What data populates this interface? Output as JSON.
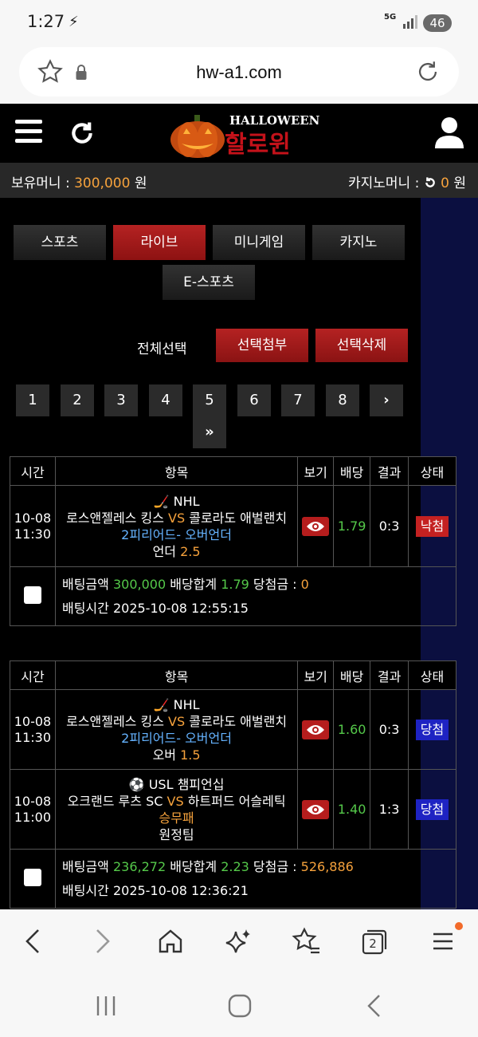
{
  "status_bar": {
    "time": "1:27",
    "network": "5G",
    "battery": "46"
  },
  "browser": {
    "url": "hw-a1.com"
  },
  "header": {
    "logo_top": "HALLOWEEN",
    "logo_main": "할로윈"
  },
  "money": {
    "holding_label": "보유머니 :",
    "holding_value": "300,000",
    "holding_unit": "원",
    "casino_label": "카지노머니 :",
    "casino_value": "0",
    "casino_unit": "원"
  },
  "tabs": [
    "스포츠",
    "라이브",
    "미니게임",
    "카지노",
    "E-스포츠"
  ],
  "active_tab": "라이브",
  "actions": {
    "select_all": "전체선택",
    "attach": "선택첨부",
    "delete": "선택삭제"
  },
  "pagination": [
    "1",
    "2",
    "3",
    "4",
    "5",
    "6",
    "7",
    "8",
    "›",
    "»"
  ],
  "columns": [
    "시간",
    "항목",
    "보기",
    "배당",
    "결과",
    "상태"
  ],
  "bets": [
    {
      "rows": [
        {
          "date": "10-08",
          "time": "11:30",
          "sport_icon": "hockey-icon",
          "league": "NHL",
          "home": "로스앤젤레스 킹스",
          "vs": "VS",
          "away": "콜로라도 애벌랜치",
          "market": "2피리어드- 오버언더",
          "pick": "언더",
          "pick_value": "2.5",
          "odds": "1.79",
          "result": "0:3",
          "status": "낙첨",
          "status_type": "lose"
        }
      ],
      "footer": {
        "amount_label": "배팅금액",
        "amount": "300,000",
        "total_label": "배당합계",
        "total": "1.79",
        "win_label": "당첨금 :",
        "win": "0",
        "time_label": "배팅시간",
        "time": "2025-10-08 12:55:15"
      }
    },
    {
      "rows": [
        {
          "date": "10-08",
          "time": "11:30",
          "sport_icon": "hockey-icon",
          "league": "NHL",
          "home": "로스앤젤레스 킹스",
          "vs": "VS",
          "away": "콜로라도 애벌랜치",
          "market": "2피리어드- 오버언더",
          "pick": "오버",
          "pick_value": "1.5",
          "odds": "1.60",
          "result": "0:3",
          "status": "당첨",
          "status_type": "win"
        },
        {
          "date": "10-08",
          "time": "11:00",
          "sport_icon": "soccer-icon",
          "league": "USL 챔피언십",
          "home": "오크랜드 루츠 SC",
          "vs": "VS",
          "away": "하트퍼드 어슬레틱",
          "market": "승무패",
          "pick": "원정팀",
          "pick_value": "",
          "odds": "1.40",
          "result": "1:3",
          "status": "당첨",
          "status_type": "win"
        }
      ],
      "footer": {
        "amount_label": "배팅금액",
        "amount": "236,272",
        "total_label": "배당합계",
        "total": "2.23",
        "win_label": "당첨금 :",
        "win": "526,886",
        "time_label": "배팅시간",
        "time": "2025-10-08 12:36:21"
      }
    }
  ],
  "bottom_nav": {
    "tab_count": "2"
  }
}
